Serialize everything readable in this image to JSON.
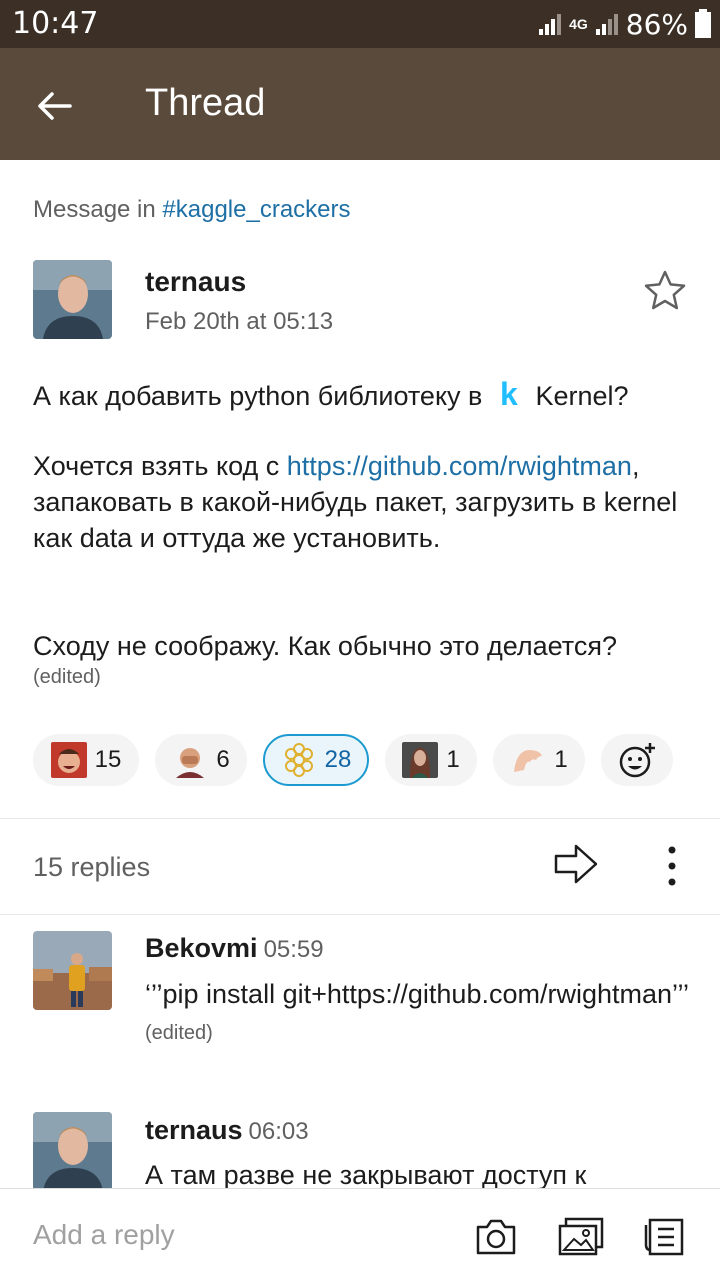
{
  "status_bar": {
    "time": "10:47",
    "network": "4G",
    "battery": "86%"
  },
  "app_bar": {
    "title": "Thread",
    "back_icon": "arrow-left-icon"
  },
  "thread": {
    "message_in_prefix": "Message in",
    "channel": "#kaggle_crackers",
    "author": "ternaus",
    "timestamp": "Feb 20th at 05:13",
    "star_icon": "star-outline-icon",
    "body": {
      "p1_before": "А как добавить python библиотеку в",
      "p1_logo": "k",
      "p1_after": "Kernel?",
      "p2_before": "Хочется взять код с ",
      "p2_link": "https://github.com/rwightman",
      "p2_after": ", запаковать в какой-нибудь пакет, загрузить в kernel как data и оттуда же установить.",
      "p3": "Сходу не соображу. Как обычно это делается?",
      "edited": "(edited)"
    },
    "reactions": [
      {
        "emoji": "laughing-man-emoji",
        "count": "15",
        "active": false
      },
      {
        "emoji": "facepalm-emoji",
        "count": "6",
        "active": false
      },
      {
        "emoji": "sunflower-pattern-emoji",
        "count": "28",
        "active": true
      },
      {
        "emoji": "woman-portrait-emoji",
        "count": "1",
        "active": false
      },
      {
        "emoji": "hand-emoji",
        "count": "1",
        "active": false
      }
    ],
    "add_reaction_icon": "add-reaction-icon"
  },
  "replies_header": {
    "count_label": "15 replies",
    "share_icon": "share-arrow-icon",
    "more_icon": "more-vertical-icon"
  },
  "replies": [
    {
      "author": "Bekovmi",
      "time": "05:59",
      "text": "‘’’pip install git+https://github.com/rwightman’’’",
      "edited": "(edited)"
    },
    {
      "author": "ternaus",
      "time": "06:03",
      "text": "А там разве не закрывают доступ к"
    }
  ],
  "composer": {
    "placeholder": "Add a reply",
    "icons": [
      "camera-icon",
      "image-icon",
      "file-icon"
    ]
  },
  "colors": {
    "status_bar": "#3b2f26",
    "app_bar": "#5a4a3b",
    "link": "#1d6fa5",
    "active_reaction_border": "#1d9bd1"
  }
}
